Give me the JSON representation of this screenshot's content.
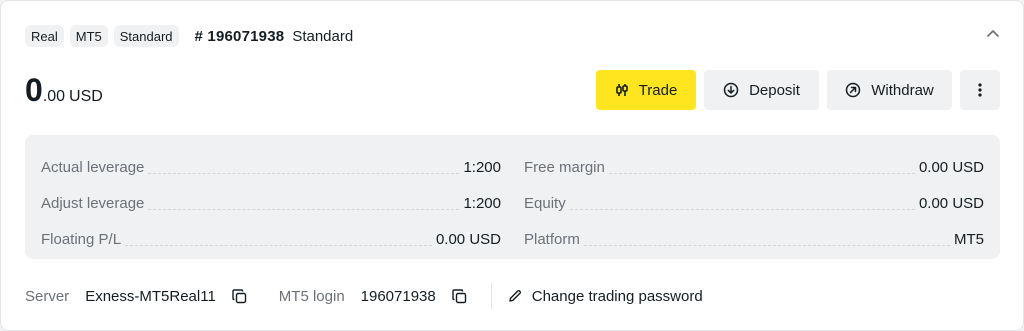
{
  "header": {
    "chips": [
      "Real",
      "MT5",
      "Standard"
    ],
    "account_number": "# 196071938",
    "account_type": "Standard"
  },
  "balance": {
    "integer": "0",
    "decimal": ".00",
    "currency": "USD"
  },
  "actions": {
    "trade": "Trade",
    "deposit": "Deposit",
    "withdraw": "Withdraw"
  },
  "stats": {
    "left": [
      {
        "label": "Actual leverage",
        "value": "1:200"
      },
      {
        "label": "Adjust leverage",
        "value": "1:200"
      },
      {
        "label": "Floating P/L",
        "value": "0.00 USD"
      }
    ],
    "right": [
      {
        "label": "Free margin",
        "value": "0.00 USD"
      },
      {
        "label": "Equity",
        "value": "0.00 USD"
      },
      {
        "label": "Platform",
        "value": "MT5"
      }
    ]
  },
  "footer": {
    "server_label": "Server",
    "server_value": "Exness-MT5Real11",
    "login_label": "MT5 login",
    "login_value": "196071938",
    "change_password": "Change trading password"
  },
  "colors": {
    "accent": "#ffe51f",
    "panel": "#f0f1f2",
    "text": "#141d22",
    "muted": "#6b7178"
  },
  "icons": {
    "collapse": "chevron-up-icon",
    "trade": "candlestick-icon",
    "deposit": "arrow-down-circle-icon",
    "withdraw": "arrow-up-right-circle-icon",
    "more": "more-vertical-icon",
    "copy": "copy-icon",
    "edit": "pencil-icon"
  }
}
